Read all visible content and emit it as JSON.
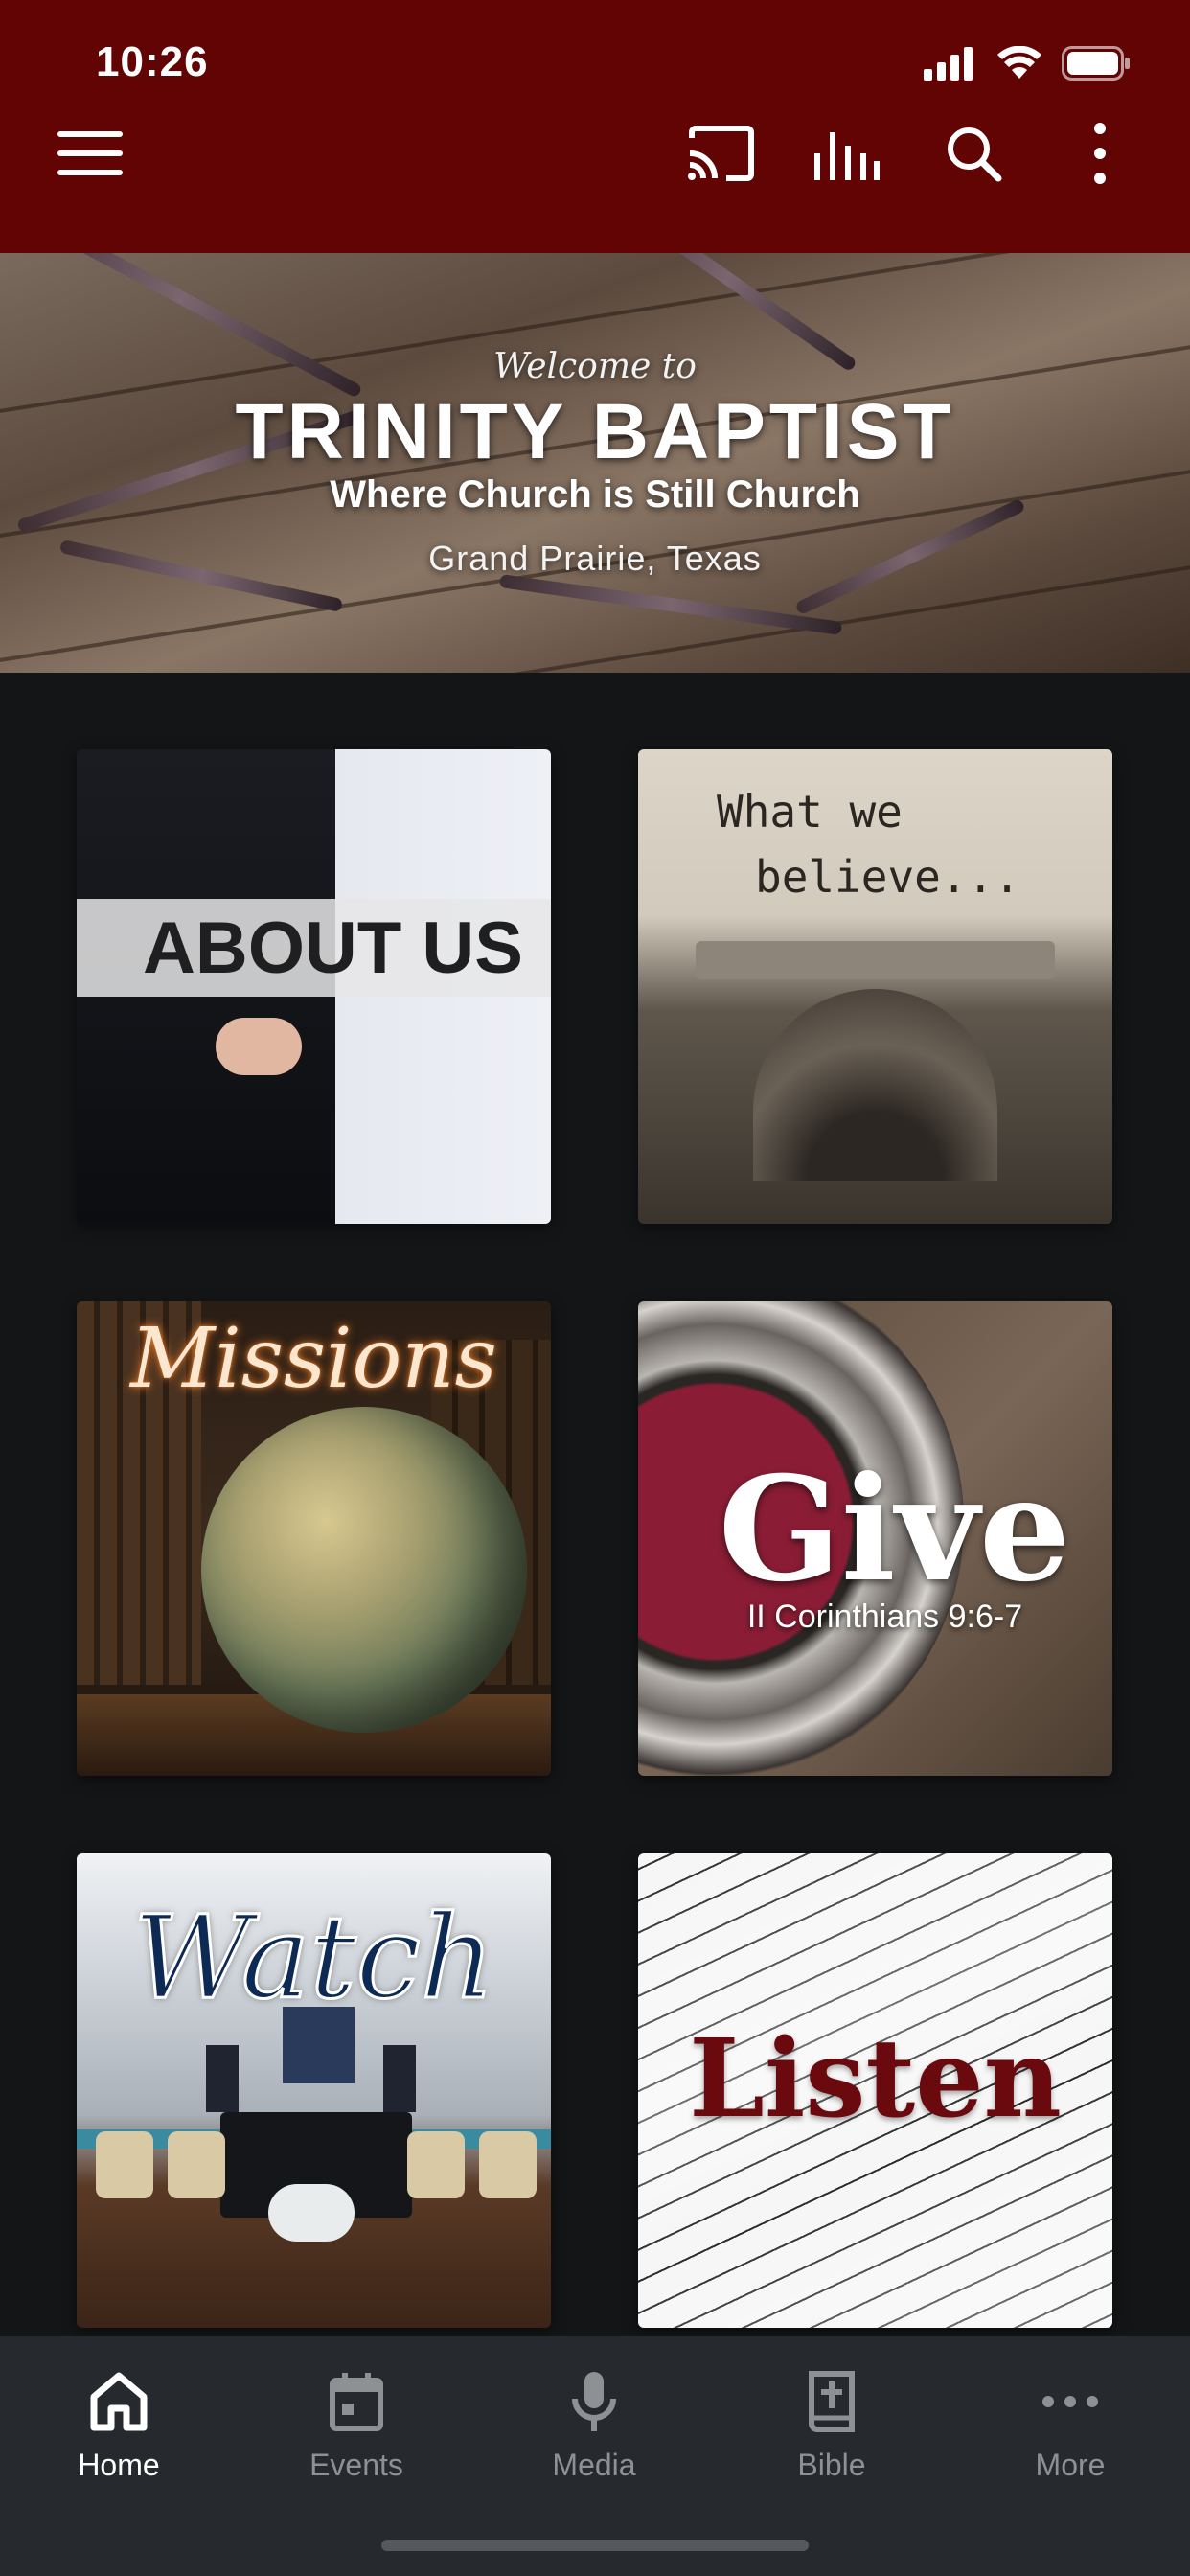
{
  "status_bar": {
    "time": "10:26"
  },
  "hero": {
    "welcome": "Welcome to",
    "title": "TRINITY BAPTIST",
    "tagline": "Where Church is Still Church",
    "location": "Grand Prairie, Texas"
  },
  "tiles": [
    {
      "label": "ABOUT US"
    },
    {
      "line1": "What we",
      "line2": "believe..."
    },
    {
      "label": "Missions"
    },
    {
      "label": "Give",
      "sublabel": "II Corinthians 9:6-7"
    },
    {
      "label": "Watch"
    },
    {
      "label": "Listen"
    }
  ],
  "bottom_nav": {
    "items": [
      {
        "label": "Home",
        "icon": "home-icon",
        "active": true
      },
      {
        "label": "Events",
        "icon": "calendar-icon"
      },
      {
        "label": "Media",
        "icon": "microphone-icon"
      },
      {
        "label": "Bible",
        "icon": "bible-icon"
      },
      {
        "label": "More",
        "icon": "more-dots-icon"
      }
    ]
  },
  "colors": {
    "app_bar": "#620304",
    "background": "#131517",
    "nav_bar": "#262a2e",
    "nav_inactive": "#8d9194"
  }
}
